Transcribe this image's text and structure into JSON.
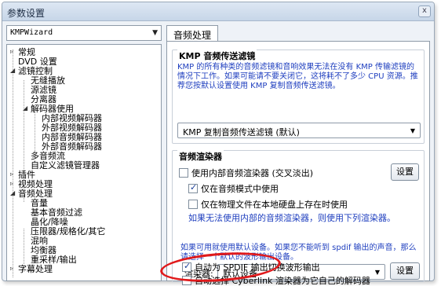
{
  "window": {
    "title": "参数设置",
    "close_label": "x"
  },
  "left": {
    "profile": "KMPWizard",
    "tree": [
      "常规",
      "DVD 设置",
      "滤镜控制",
      "无缝播放",
      "源滤镜",
      "分离器",
      "解码器使用",
      "内部视频解码器",
      "外部视频解码器",
      "内部音频解码器",
      "外部音频解码器",
      "多音频流",
      "自定义滤镜管理器",
      "插件",
      "视频处理",
      "音频处理",
      "音量",
      "基本音频过滤",
      "晶化/降噪",
      "压限器/规格化/其它",
      "混响",
      "均衡器",
      "重采样/输出",
      "字幕处理"
    ]
  },
  "right": {
    "tab": "音频处理",
    "passthrough": {
      "title": "KMP 音频传送滤镜",
      "desc": "KMP 的所有种类的音频滤镜和音响效果无法在没有 KMP 传输滤镜的情况下工作。如果可能请不要关闭它，这将耗不了多少 CPU 资源。推荐您按默认设置使用 KMP 复制音频传送滤镜。",
      "selected": "KMP 复制音频传送滤镜 (默认)"
    },
    "renderer": {
      "title": "音频渲染器",
      "use_internal": "使用内部音频渲染器 (交叉淡出)",
      "settings": "设置",
      "audio_only": "仅在音频模式中使用",
      "physical_only": "仅在物理文件在本地硬盘上存在时使用",
      "fallback_note": "如果无法使用内部的音频渲染器，则使用下列渲染器。",
      "default_note": "如果可用就使用默认设备。如果您不能听到 spdif 输出的声音，那么请选择一个默认的波形输出设备。",
      "renderer_label": "渲染器:",
      "renderer_value": "默认设备",
      "settings2": "设置",
      "auto_spdif": "自动为 SPDIF 输出切换波形输出",
      "auto_cyberlink": "自动选择 Cyberlink 渲染器为它自己的解码器"
    }
  }
}
